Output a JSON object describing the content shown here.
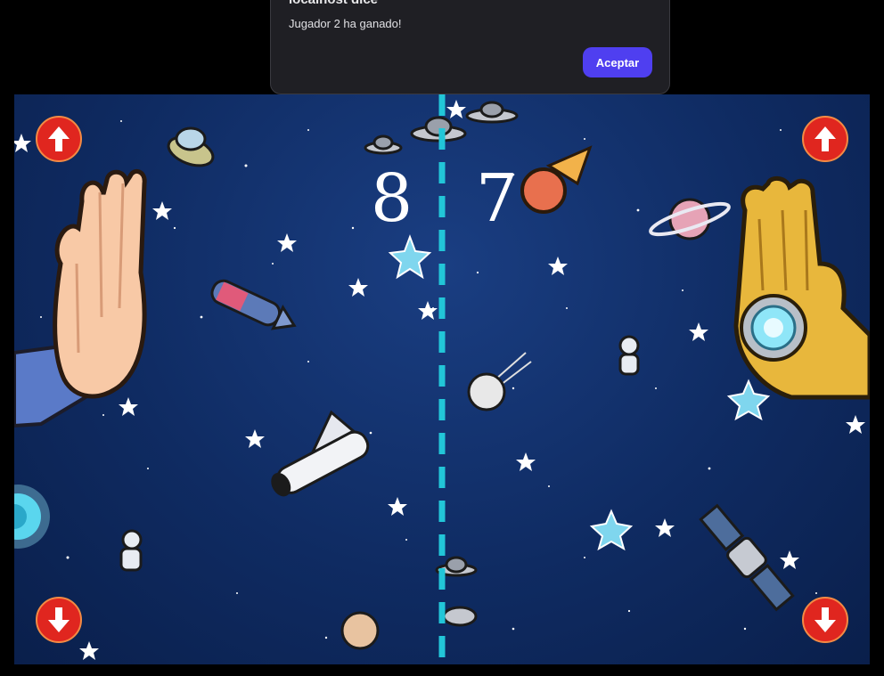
{
  "dialog": {
    "title": "localhost dice",
    "message": "Jugador 2 ha ganado!",
    "accept_label": "Aceptar"
  },
  "scores": {
    "player1": "8",
    "player2": "7"
  },
  "controls": {
    "left_up_icon": "arrow-up-icon",
    "left_down_icon": "arrow-down-icon",
    "right_up_icon": "arrow-up-icon",
    "right_down_icon": "arrow-down-icon"
  },
  "colors": {
    "accent_button": "#4f3ff0",
    "midline": "#22c6d8",
    "control_red": "#e0261f",
    "space_bg": "#0f2b62"
  }
}
